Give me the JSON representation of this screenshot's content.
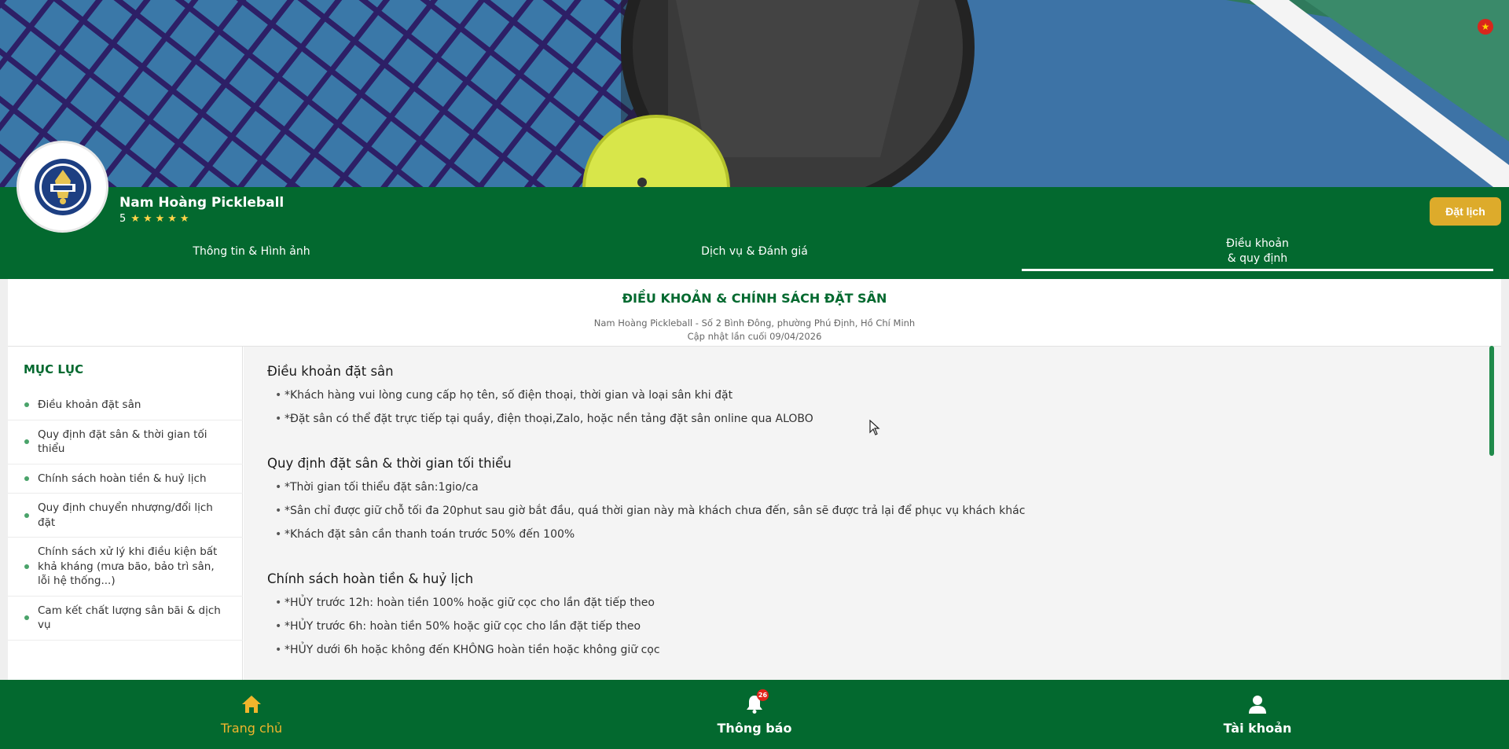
{
  "club": {
    "name": "Nam Hoàng Pickleball",
    "rating_value": "5",
    "star_glyph": "★",
    "stars": 5,
    "book_button": "Đặt lịch",
    "logo_icon": "nam-hoang-pickleball-logo"
  },
  "tabs": {
    "info": "Thông tin & Hình ảnh",
    "services": "Dịch vụ & Đánh giá",
    "terms_line1": "Điều khoản",
    "terms_line2": "& quy định",
    "active": "terms"
  },
  "document": {
    "title": "ĐIỀU KHOẢN & CHÍNH SÁCH ĐẶT SÂN",
    "address": "Nam Hoàng Pickleball - Số 2 Bình Đông, phường Phú Định, Hồ Chí Minh",
    "updated": "Cập nhật lần cuối 09/04/2026"
  },
  "toc": {
    "title": "MỤC LỤC",
    "items": [
      "Điều khoản đặt sân",
      "Quy định đặt sân & thời gian tối thiểu",
      "Chính sách hoàn tiền & huỷ lịch",
      "Quy định chuyển nhượng/đổi lịch đặt",
      "Chính sách xử lý khi điều kiện bất khả kháng (mưa bão, bảo trì sân, lỗi hệ thống...)",
      "Cam kết chất lượng sân bãi & dịch vụ"
    ]
  },
  "sections": [
    {
      "title": "Điều khoản đặt sân",
      "bullets": [
        "*Khách hàng vui lòng cung cấp họ tên, số điện thoại, thời gian và loại sân khi đặt",
        "*Đặt sân có thể đặt trực tiếp tại quầy, điện thoại,Zalo, hoặc nền tảng đặt sân online qua ALOBO"
      ]
    },
    {
      "title": "Quy định đặt sân & thời gian tối thiểu",
      "bullets": [
        "*Thời gian tối thiểu đặt sân:1gio/ca",
        "*Sân chỉ được giữ chỗ tối đa 20phut sau giờ bắt đầu, quá thời gian này mà khách chưa đến, sân sẽ được trả lại để phục vụ khách khác",
        "*Khách đặt sân cần thanh toán trước 50% đến 100%"
      ]
    },
    {
      "title": "Chính sách hoàn tiền & huỷ lịch",
      "bullets": [
        "*HỦY trước 12h: hoàn tiền 100% hoặc giữ cọc cho lần đặt tiếp theo",
        "*HỦY trước 6h: hoàn tiền 50% hoặc giữ cọc cho lần đặt tiếp theo",
        "*HỦY dưới 6h hoặc không đến KHÔNG hoàn tiền hoặc không giữ cọc"
      ]
    }
  ],
  "bottom_nav": {
    "home": "Trang chủ",
    "notifications": "Thông báo",
    "notification_count": "26",
    "account": "Tài khoản",
    "active": "home"
  },
  "colors": {
    "brand_green": "#03692f",
    "accent_gold": "#ddab2b",
    "active_nav": "#f0b52c",
    "badge_red": "#e0241b"
  },
  "icons": {
    "home": "home-icon",
    "notifications": "bell-icon",
    "account": "user-icon",
    "language": "vietnam-flag-icon"
  }
}
